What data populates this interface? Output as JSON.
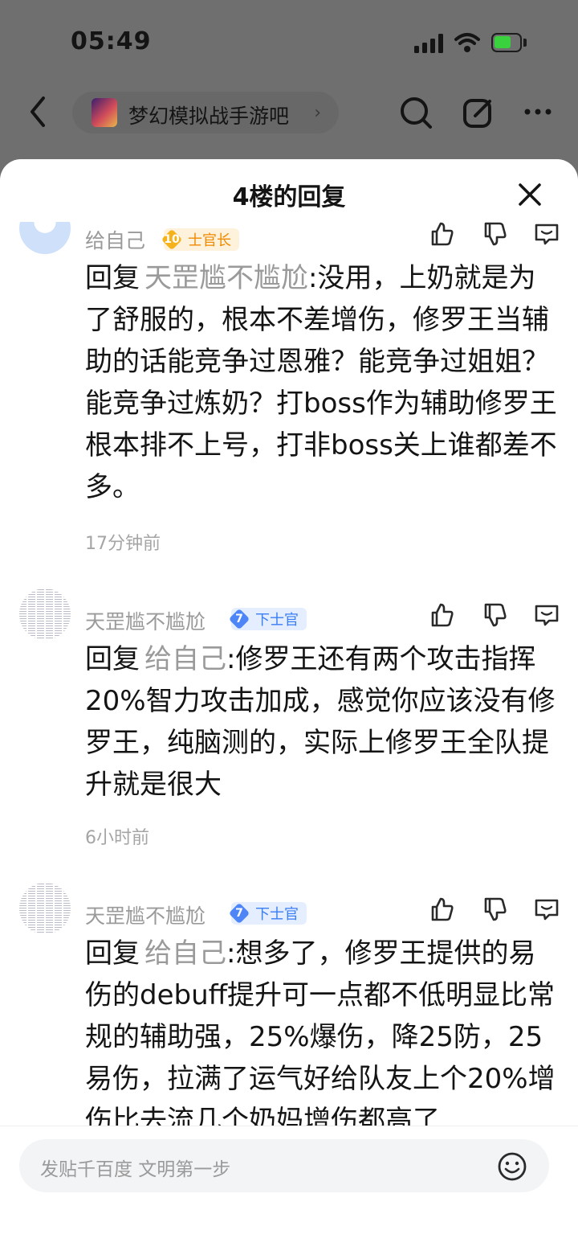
{
  "status_bar": {
    "time": "05:49"
  },
  "nav": {
    "forum_name": "梦幻模拟战手游吧",
    "chevron": "›"
  },
  "sheet": {
    "title": "4楼的回复"
  },
  "replies": [
    {
      "user": "给自己",
      "level": "10",
      "rank": "士官长",
      "prefix": "回复",
      "mention": "天罡尴不尴尬",
      "text": ":没用，上奶就是为了舒服的，根本不差增伤，修罗王当辅助的话能竞争过恩雅？能竞争过姐姐？能竞争过炼奶？打boss作为辅助修罗王根本排不上号，打非boss关上谁都差不多。",
      "time": "17分钟前"
    },
    {
      "user": "天罡尴不尴尬",
      "level": "7",
      "rank": "下士官",
      "prefix": "回复",
      "mention": "给自己",
      "text": ":修罗王还有两个攻击指挥20%智力攻击加成，感觉你应该没有修罗王，纯脑测的，实际上修罗王全队提升就是很大",
      "time": "6小时前"
    },
    {
      "user": "天罡尴不尴尬",
      "level": "7",
      "rank": "下士官",
      "prefix": "回复",
      "mention": "给自己",
      "text": ":想多了，修罗王提供的易伤的debuff提升可一点都不低明显比常规的辅助强，25%爆伤，降25防，25易伤，拉满了运气好给队友上个20%增伤比去流几个奶妈增伤都高了",
      "time": ""
    }
  ],
  "composer": {
    "placeholder": "发贴千百度 文明第一步"
  },
  "colors": {
    "accent_blue": "#4e86f7",
    "accent_gold": "#f6b21b",
    "muted_text": "#9a9a9a",
    "overlay": "#6f6f6f"
  }
}
